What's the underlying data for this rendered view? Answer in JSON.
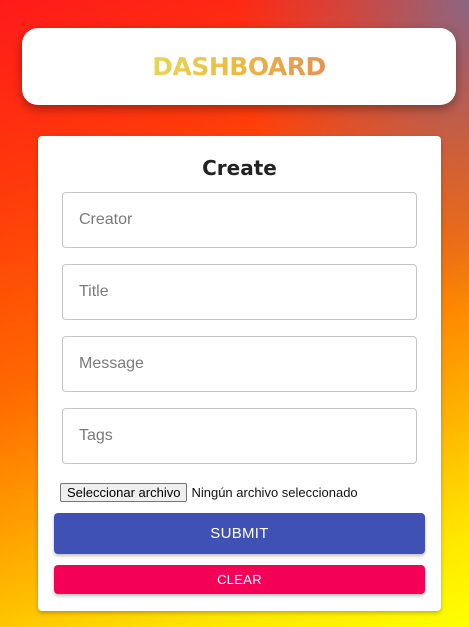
{
  "header": {
    "logo_text": "DASHBOARD"
  },
  "form": {
    "title": "Create",
    "fields": [
      {
        "placeholder": "Creator",
        "value": ""
      },
      {
        "placeholder": "Title",
        "value": ""
      },
      {
        "placeholder": "Message",
        "value": ""
      },
      {
        "placeholder": "Tags",
        "value": ""
      }
    ],
    "file_button_label": "Seleccionar archivo",
    "file_status": "Ningún archivo seleccionado",
    "submit_label": "SUBMIT",
    "clear_label": "CLEAR"
  },
  "colors": {
    "submit": "#3f51b5",
    "clear": "#f50057",
    "logo_gradient_start": "#f2e35a",
    "logo_gradient_end": "#f29a55",
    "background_start": "#ff1a1a",
    "background_end": "#ffff00"
  }
}
